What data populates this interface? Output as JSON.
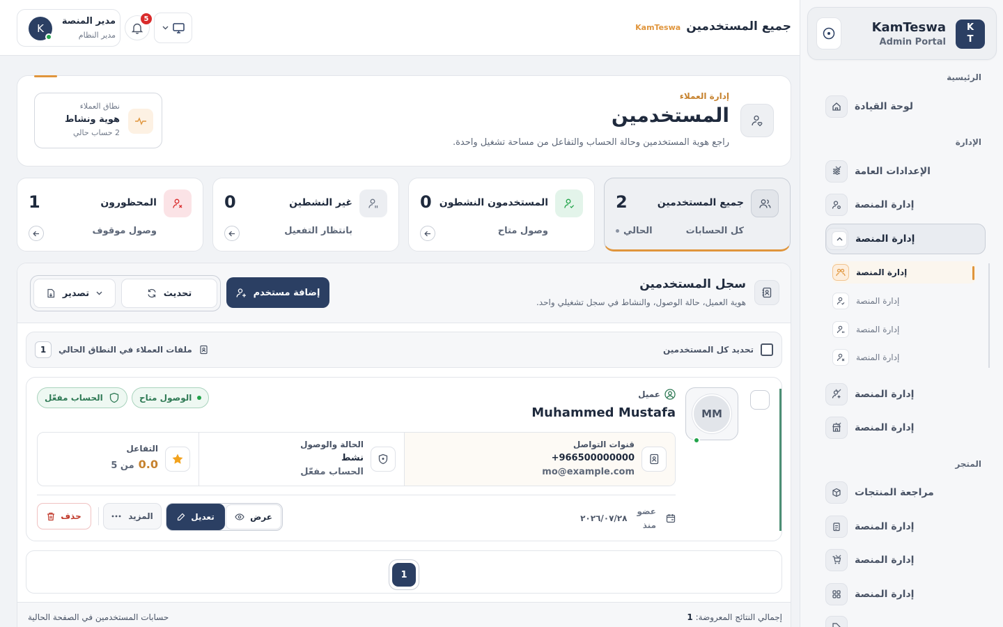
{
  "sidebar": {
    "brand": {
      "logo_line1": "K",
      "logo_line2": "T",
      "title": "KamTeswa",
      "subtitle": "Admin Portal"
    },
    "sections": {
      "main": "الرئيسية",
      "management": "الإدارة",
      "store": "المتجر"
    },
    "items": [
      {
        "label": "لوحة القيادة",
        "icon": "home-icon"
      },
      {
        "label": "الإعدادات العامة",
        "icon": "sliders-icon"
      },
      {
        "label": "إدارة المنصة",
        "icon": "user-gear-icon"
      },
      {
        "label": "إدارة المنصة",
        "icon": "users-icon",
        "expanded": true
      },
      {
        "label": "إدارة المنصة",
        "icon": "user-plus-icon"
      },
      {
        "label": "إدارة المنصة",
        "icon": "store-icon"
      },
      {
        "label": "مراجعة المنتجات",
        "icon": "box-icon"
      },
      {
        "label": "إدارة المنصة",
        "icon": "clipboard-icon"
      },
      {
        "label": "إدارة المنصة",
        "icon": "cart-icon"
      },
      {
        "label": "إدارة المنصة",
        "icon": "grid-icon"
      }
    ],
    "sub_items": [
      {
        "label": "إدارة المنصة",
        "active": true
      },
      {
        "label": "إدارة المنصة"
      },
      {
        "label": "إدارة المنصة"
      },
      {
        "label": "إدارة المنصة"
      }
    ]
  },
  "header": {
    "title": "جميع المستخدمين",
    "brand": "KamTeswa",
    "user": {
      "initial": "K",
      "name": "مدير المنصة",
      "role": "مدير النظام"
    },
    "notifications_count": "5"
  },
  "hero": {
    "eyebrow": "إدارة العملاء",
    "title": "المستخدمين",
    "description": "راجع هوية المستخدمين وحالة الحساب والتفاعل من مساحة تشغيل واحدة.",
    "scope": {
      "label": "نطاق العملاء",
      "value": "هوية ونشاط",
      "sub": "2 حساب حالي"
    }
  },
  "stats": [
    {
      "title": "جميع المستخدمين",
      "count": "2",
      "sub": "كل الحسابات",
      "current_label": "الحالي",
      "active": true,
      "icon_bg": "#e2e5ea"
    },
    {
      "title": "المستخدمون النشطون",
      "count": "0",
      "sub": "وصول متاح",
      "icon_bg": "#e3f4ea"
    },
    {
      "title": "غير النشطين",
      "count": "0",
      "sub": "بانتظار التفعيل",
      "icon_bg": "#eceef2"
    },
    {
      "title": "المحظورون",
      "count": "1",
      "sub": "وصول موقوف",
      "icon_bg": "#fbe3e6"
    }
  ],
  "registry": {
    "title": "سجل المستخدمين",
    "description": "هوية العميل، حالة الوصول، والنشاط في سجل تشغيلي واحد.",
    "add_button": "إضافة مستخدم",
    "refresh_button": "تحديث",
    "export_button": "تصدير",
    "select_all": "تحديد كل المستخدمين",
    "files_label": "ملفات العملاء في النطاق الحالي",
    "files_count": "1"
  },
  "user_card": {
    "initials": "MM",
    "type": "عميل",
    "name": "Muhammed Mustafa",
    "badge_access": "الوصول متاح",
    "badge_account": "الحساب مفعّل",
    "contact": {
      "label": "قنوات التواصل",
      "phone": "+966500000000",
      "email": "mo@example.com"
    },
    "status": {
      "label": "الحالة والوصول",
      "state": "نشط",
      "account": "الحساب مفعّل"
    },
    "engagement": {
      "label": "التفاعل",
      "score": "0.0",
      "out_of": "من 5"
    },
    "member_label_1": "عضو",
    "member_label_2": "منذ",
    "member_since": "٢٠٢٦/٠٧/٢٨",
    "view_button": "عرض",
    "edit_button": "تعديل",
    "more_button": "المزيد",
    "delete_button": "حذف"
  },
  "pagination": {
    "current_page": "1"
  },
  "footer": {
    "total_label": "إجمالي النتائج المعروضة:",
    "total_value": "1",
    "note": "حسابات المستخدمين في الصفحة الحالية"
  },
  "colors": {
    "primary": "#2b3f63",
    "accent": "#e0953c",
    "success": "#22a34a",
    "danger": "#d92b2b"
  }
}
